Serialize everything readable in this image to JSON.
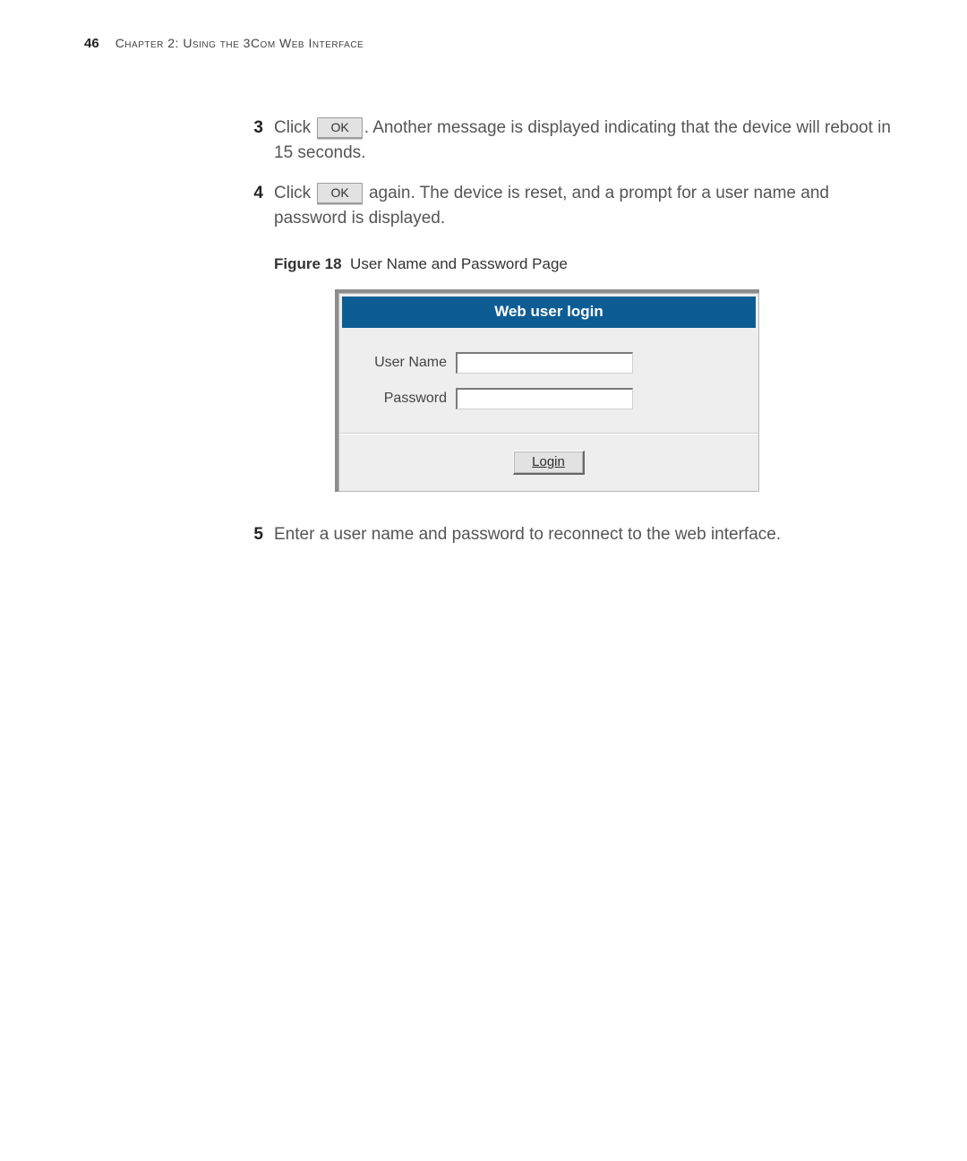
{
  "header": {
    "page_number": "46",
    "chapter_title": "Chapter 2: Using the 3Com Web Interface"
  },
  "steps": {
    "s3": {
      "num": "3",
      "before": "Click ",
      "button": "OK",
      "after": ". Another message is displayed indicating that the device will reboot in 15 seconds."
    },
    "s4": {
      "num": "4",
      "before": "Click ",
      "button": "OK",
      "after": " again. The device is reset, and a prompt for a user name and password is displayed."
    },
    "s5": {
      "num": "5",
      "text": "Enter a user name and password to reconnect to the web interface."
    }
  },
  "figure": {
    "label": "Figure 18",
    "caption": "User Name and Password Page"
  },
  "login_panel": {
    "title": "Web user login",
    "username_label": "User Name",
    "password_label": "Password",
    "username_value": "",
    "password_value": "",
    "login_button": "Login"
  }
}
